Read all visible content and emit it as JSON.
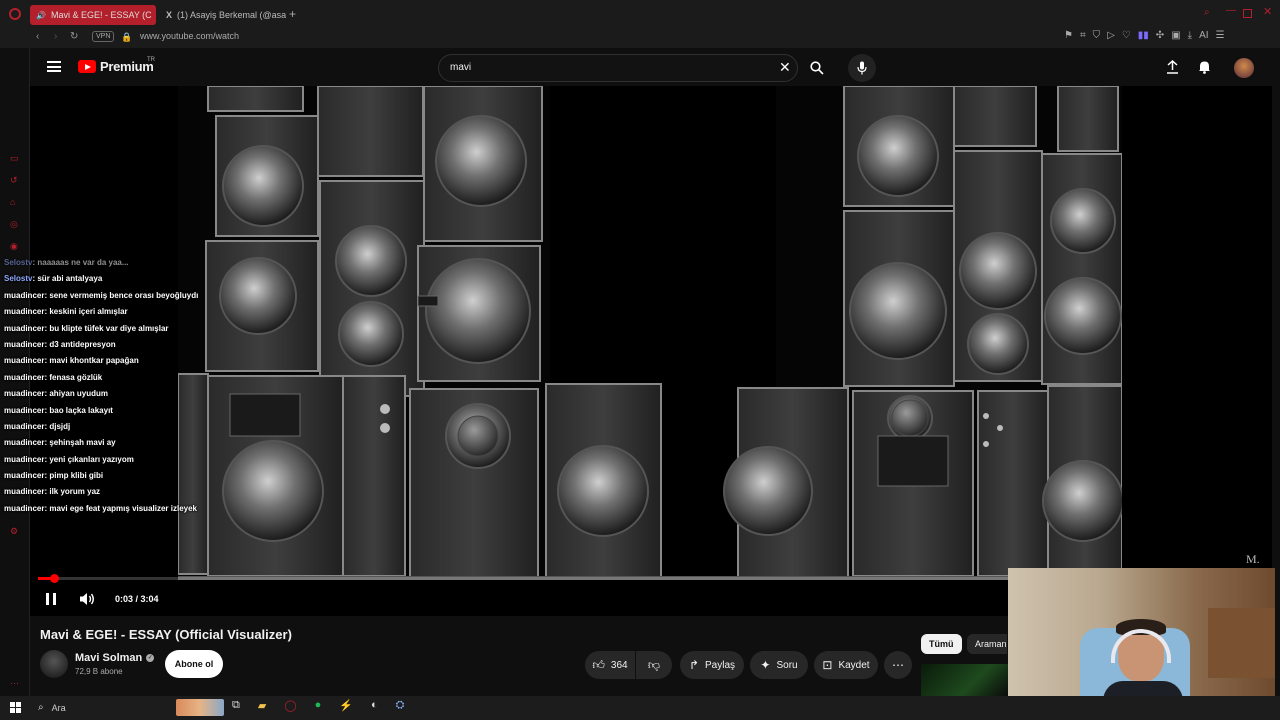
{
  "browser": {
    "tabs": [
      {
        "label": "Mavi & EGE! - ESSAY (C",
        "active": true
      },
      {
        "label": "(1) Asayiş Berkemal (@asay",
        "active": false
      }
    ],
    "vpn_label": "VPN",
    "url": "www.youtube.com/watch",
    "ai_label": "AI"
  },
  "youtube": {
    "logo_text": "Premium",
    "region": "TR",
    "search_value": "mavi"
  },
  "video": {
    "watermark": "M.",
    "time_display": "0:03 / 3:04",
    "progress": 0.016,
    "title": "Mavi & EGE! - ESSAY (Official Visualizer)",
    "channel_name": "Mavi Solman",
    "subscribers": "72,9 B abone",
    "subscribe_label": "Abone ol",
    "likes": "364",
    "share_label": "Paylaş",
    "ask_label": "Soru",
    "save_label": "Kaydet",
    "chips": [
      "Tümü",
      "Araman"
    ]
  },
  "chat": [
    {
      "user": "Selostv",
      "msg": ": naaaaas ne var da yaa...",
      "partial": true
    },
    {
      "user": "Selostv",
      "msg": ": sür abi antalyaya"
    },
    {
      "user": "muadincer",
      "msg": ": sene vermemiş bence orası beyoğluydı"
    },
    {
      "user": "muadincer",
      "msg": ": keskini içeri almışlar"
    },
    {
      "user": "muadincer",
      "msg": ": bu klipte tüfek var diye almışlar"
    },
    {
      "user": "muadincer",
      "msg": ": d3 antidepresyon"
    },
    {
      "user": "muadincer",
      "msg": ": mavi khontkar papağan"
    },
    {
      "user": "muadincer",
      "msg": ": fenasa gözlük"
    },
    {
      "user": "muadincer",
      "msg": ": ahiyan uyudum"
    },
    {
      "user": "muadincer",
      "msg": ": bao laçka lakayıt"
    },
    {
      "user": "muadincer",
      "msg": ": djsjdj"
    },
    {
      "user": "muadincer",
      "msg": ": şehinşah mavi ay"
    },
    {
      "user": "muadincer",
      "msg": ": yeni çıkanları yazıyom"
    },
    {
      "user": "muadincer",
      "msg": ": pimp klibi gibi"
    },
    {
      "user": "muadincer",
      "msg": ": ilk yorum yaz"
    },
    {
      "user": "muadincer",
      "msg": ": mavi ege feat yapmış visualizer izleyek"
    }
  ],
  "taskbar": {
    "search_label": "Ara"
  },
  "colors": {
    "accent": "#ff0000",
    "opera": "#b3202b",
    "background": "#0f0f0f"
  }
}
